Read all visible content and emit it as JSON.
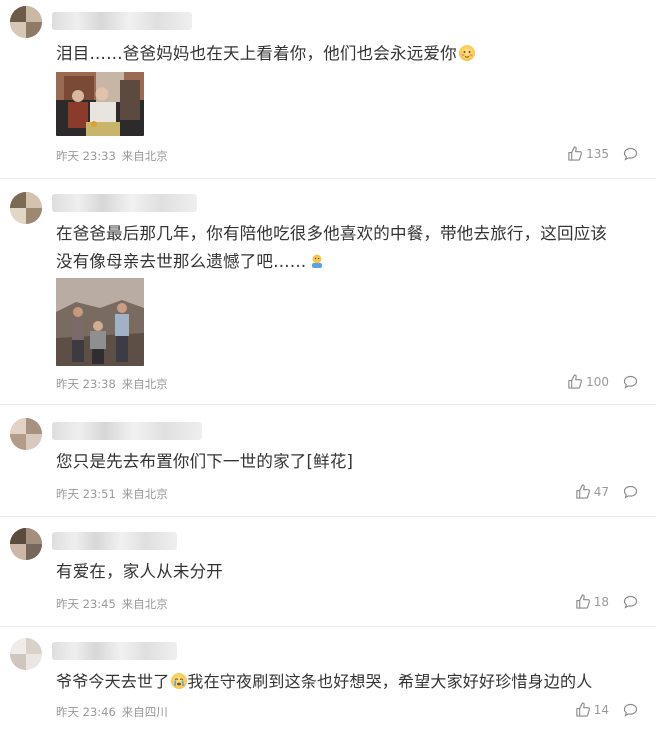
{
  "comments": [
    {
      "text": "泪目……爸爸妈妈也在天上看着你，他们也会永远爱你",
      "emoji": "blushing-face-emoji",
      "date": "昨天 23:33",
      "location": "来自北京",
      "likes": "135",
      "photo": "old-couple-photo"
    },
    {
      "text_lines": [
        "在爸爸最后那几年，你有陪他吃很多他喜欢的中餐，带他去旅行，这回应该",
        "没有像母亲去世那么遗憾了吧……"
      ],
      "emoji": "hugging-emoji",
      "date": "昨天 23:38",
      "location": "来自北京",
      "likes": "100",
      "photo": "family-canyon-photo"
    },
    {
      "text": "您只是先去布置你们下一世的家了[鲜花]",
      "date": "昨天 23:51",
      "location": "来自北京",
      "likes": "47"
    },
    {
      "text": "有爱在，家人从未分开",
      "date": "昨天 23:45",
      "location": "来自北京",
      "likes": "18"
    },
    {
      "text_before": "爷爷今天去世了",
      "text_after": "我在守夜刷到这条也好想哭，希望大家好好珍惜身边的人",
      "emoji": "crying-face-emoji",
      "date": "昨天 23:46",
      "location": "来自四川",
      "likes": "14"
    }
  ]
}
